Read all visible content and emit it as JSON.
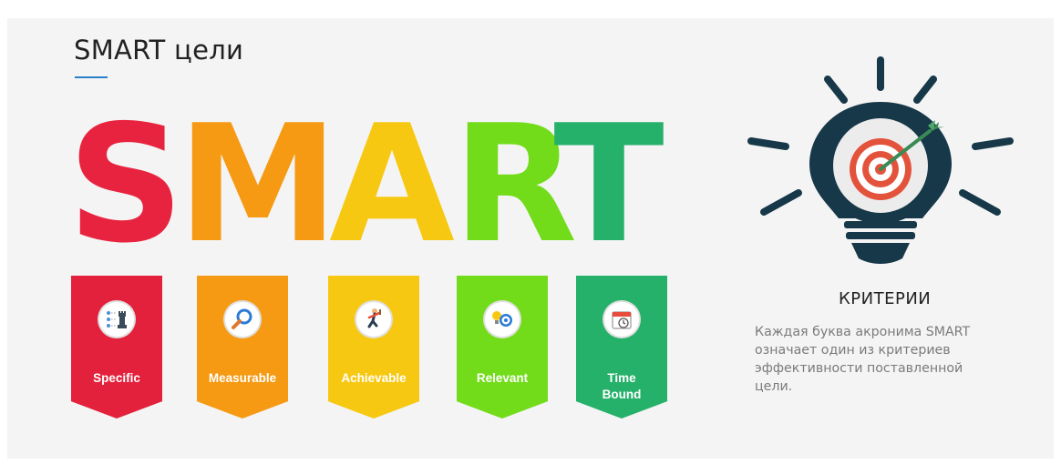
{
  "slide": {
    "title": "SMART цели"
  },
  "letters": [
    {
      "char": "S",
      "color": "#e8233f"
    },
    {
      "char": "M",
      "color": "#f59a12"
    },
    {
      "char": "A",
      "color": "#f7c812"
    },
    {
      "char": "R",
      "color": "#72dc1a"
    },
    {
      "char": "T",
      "color": "#26b16a"
    }
  ],
  "banners": [
    {
      "label": "Specific",
      "color": "#e3213c",
      "icon": "chess-strategy-icon"
    },
    {
      "label": "Measurable",
      "color": "#f59a12",
      "icon": "magnifier-icon"
    },
    {
      "label": "Achievable",
      "color": "#f7c812",
      "icon": "climber-icon"
    },
    {
      "label": "Relevant",
      "color": "#72dc1a",
      "icon": "lightbulb-target-icon"
    },
    {
      "label": "Time\nBound",
      "color": "#26b16a",
      "icon": "calendar-clock-icon"
    }
  ],
  "criteria": {
    "title": "КРИТЕРИИ",
    "description": "Каждая буква акронима SMART\nозначает один из критериев\nэффективности поставленной\nцели.",
    "icon": "lightbulb-target-icon"
  },
  "colors": {
    "background": "#f4f4f4",
    "accent_underline": "#2a7fc9",
    "bulb_dark": "#163848",
    "target_red": "#e3533c",
    "arrow_green": "#2e8b57"
  }
}
